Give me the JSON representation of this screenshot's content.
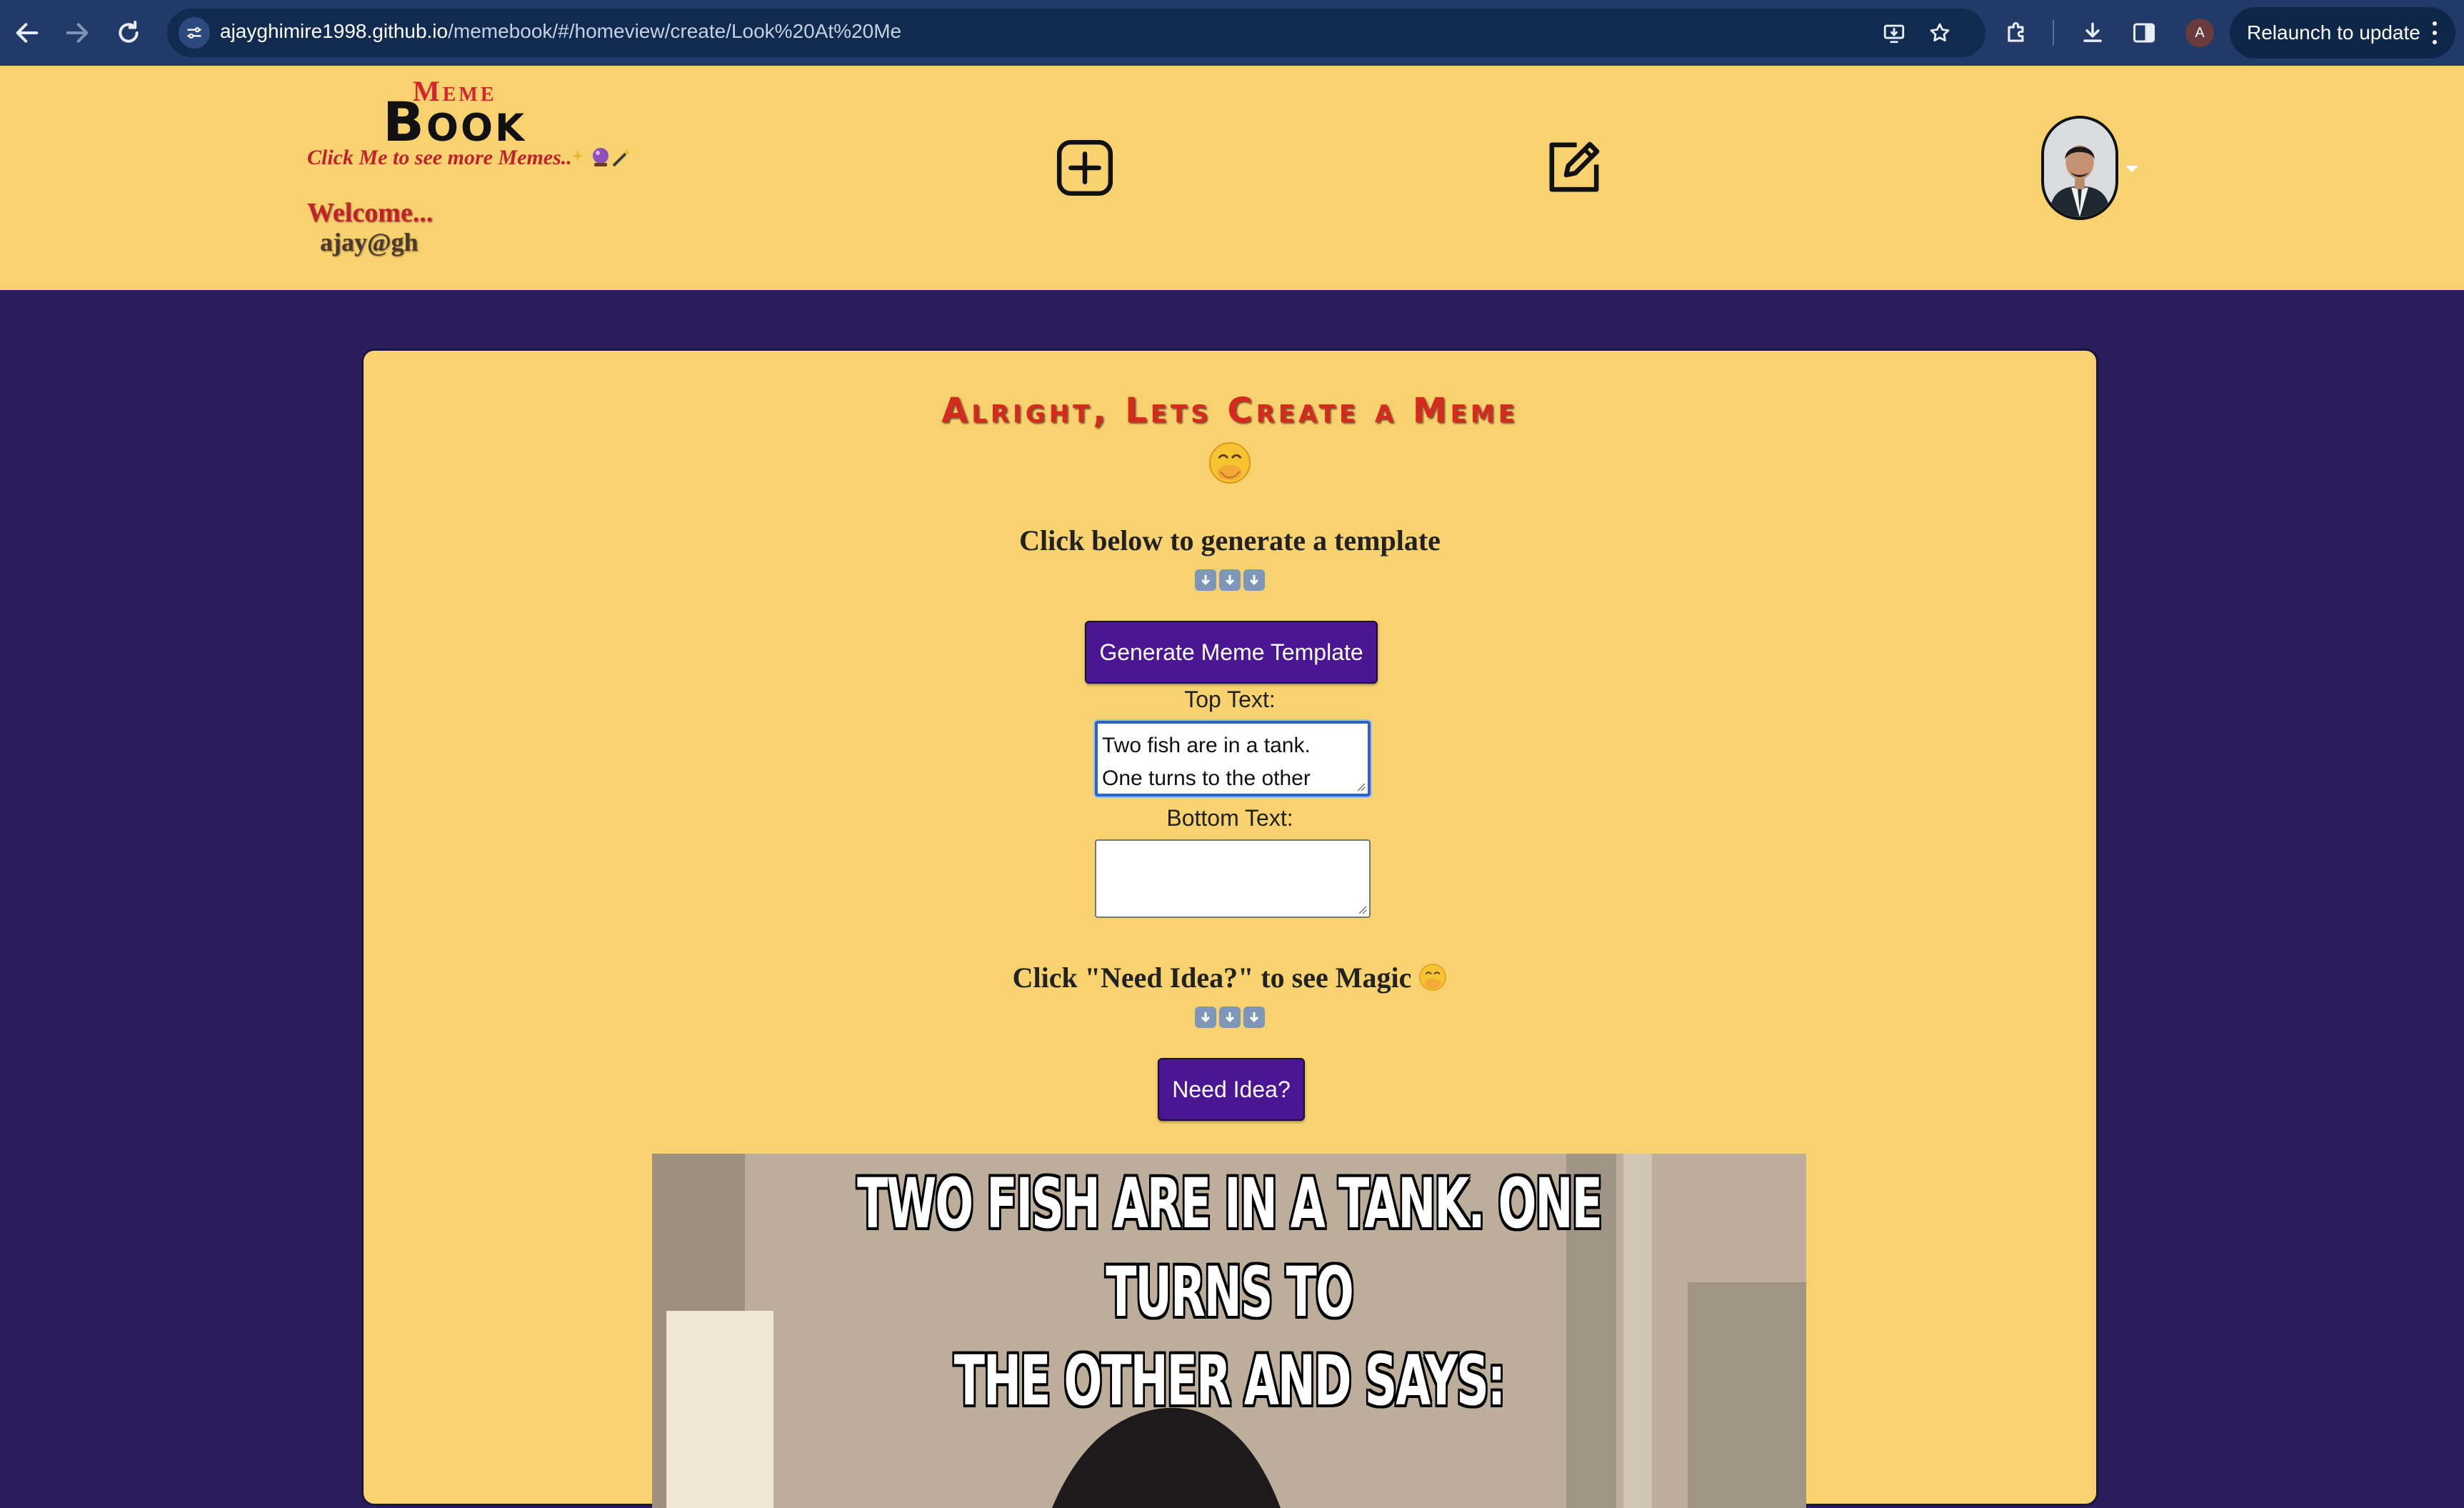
{
  "browser": {
    "url_host": "ajayghimire1998.github.io",
    "url_path": "/memebook/#/homeview/create/Look%20At%20Me",
    "profile_initial": "A",
    "relaunch_label": "Relaunch to update"
  },
  "header": {
    "logo_top": "Meme",
    "logo_bottom": "Book",
    "tagline": "Click Me to see more Memes..",
    "welcome": "Welcome...",
    "username": "ajay@gh"
  },
  "create": {
    "title": "Alright, Lets Create a Meme",
    "instruction": "Click below to generate a template",
    "generate_button": "Generate Meme Template",
    "top_text_label": "Top Text:",
    "top_text_line1": "Two fish are in a tank.",
    "top_text_line2": "One turns to the other",
    "bottom_text_label": "Bottom Text:",
    "bottom_text_value": "",
    "idea_instruction": "Click \"Need Idea?\" to see Magic",
    "idea_button": "Need Idea?"
  },
  "meme": {
    "caption_line1": "TWO FISH ARE IN A TANK. ONE TURNS TO",
    "caption_line2": "THE OTHER AND SAYS:"
  },
  "colors": {
    "chrome": "#223a68",
    "header_bg": "#f7d26e",
    "page_bg": "#291d5c",
    "button_purple": "#4b1691",
    "title_red": "#d42b1e"
  },
  "icons": {
    "back": "arrow-left-icon",
    "forward": "arrow-right-icon",
    "reload": "reload-icon",
    "add": "plus-square-icon",
    "edit": "pencil-square-icon",
    "down_arrows": "down-arrow-emoji-icon",
    "face": "hand-over-mouth-emoji-icon"
  }
}
